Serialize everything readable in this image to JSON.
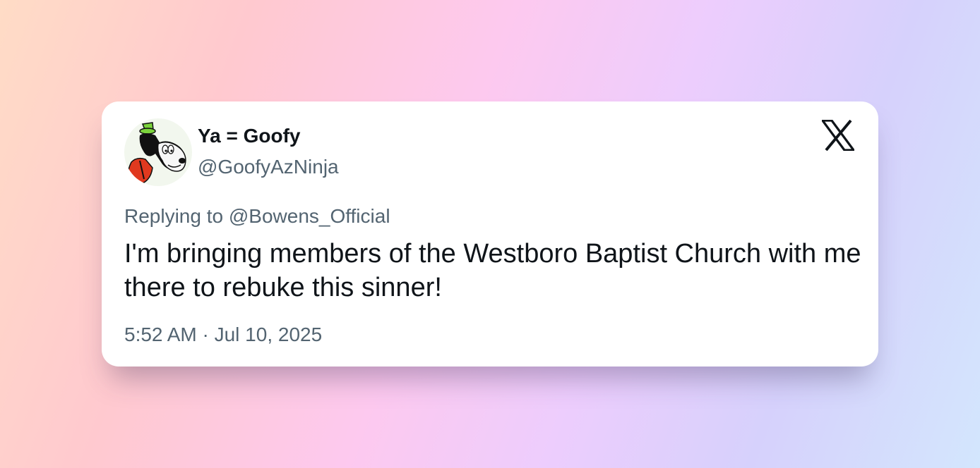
{
  "tweet": {
    "display_name": "Ya = Goofy",
    "handle": "@GoofyAzNinja",
    "replying_to": "Replying to @Bowens_Official",
    "text": "I'm bringing members of the Westboro Baptist Church with me there to rebuke this sinner!",
    "timestamp": "5:52 AM · Jul 10, 2025"
  },
  "icons": {
    "logo": "x-logo-icon",
    "avatar": "goofy-avatar"
  },
  "colors": {
    "primary_text": "#0f1419",
    "secondary_text": "#536471",
    "card_background": "#ffffff"
  }
}
